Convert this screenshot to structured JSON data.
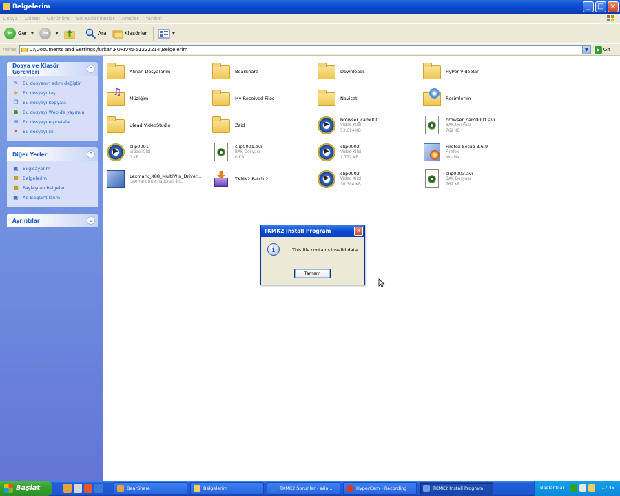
{
  "window": {
    "title": "Belgelerim",
    "controls": [
      "_",
      "□",
      "×"
    ]
  },
  "menu": [
    "Dosya",
    "Düzen",
    "Görünüm",
    "Sık Kullanılanlar",
    "Araçlar",
    "Yardım"
  ],
  "toolbar": {
    "back": "Geri",
    "search": "Ara",
    "folders": "Klasörler"
  },
  "address": {
    "label": "Adres",
    "path": "C:\\Documents and Settings\\furkan.FURKAN-51222214\\Belgelerim",
    "go": "Git"
  },
  "taskpane": {
    "file_tasks": {
      "title": "Dosya ve Klasör Görevleri",
      "items": [
        {
          "label": "Bu dosyanın adını değiştir",
          "icon": "rename-icon"
        },
        {
          "label": "Bu dosyayı taşı",
          "icon": "move-icon"
        },
        {
          "label": "Bu dosyayı kopyala",
          "icon": "copy-icon"
        },
        {
          "label": "Bu dosyayı Web'de yayımla",
          "icon": "web-publish-icon"
        },
        {
          "label": "Bu dosyayı e-postala",
          "icon": "email-icon"
        },
        {
          "label": "Bu dosyayı sil",
          "icon": "delete-icon"
        }
      ]
    },
    "other_places": {
      "title": "Diğer Yerler",
      "items": [
        {
          "label": "Bilgisayarım",
          "icon": "computer-icon"
        },
        {
          "label": "Belgelerim",
          "icon": "documents-icon"
        },
        {
          "label": "Paylaşılan Belgeler",
          "icon": "shared-folder-icon"
        },
        {
          "label": "Ağ Bağlantılarım",
          "icon": "network-icon"
        }
      ]
    },
    "details": {
      "title": "Ayrıntılar"
    }
  },
  "files": [
    {
      "name": "Alınan Dosyalarım",
      "type": "folder",
      "sub1": "",
      "sub2": ""
    },
    {
      "name": "BearShare",
      "type": "folder",
      "sub1": "",
      "sub2": ""
    },
    {
      "name": "Downloads",
      "type": "folder",
      "sub1": "",
      "sub2": ""
    },
    {
      "name": "HyPer Videolar",
      "type": "folder",
      "sub1": "",
      "sub2": ""
    },
    {
      "name": "Müziğim",
      "type": "music",
      "sub1": "",
      "sub2": ""
    },
    {
      "name": "My Received Files",
      "type": "folder",
      "sub1": "",
      "sub2": ""
    },
    {
      "name": "Navicat",
      "type": "folder",
      "sub1": "",
      "sub2": ""
    },
    {
      "name": "Resimlerim",
      "type": "pictures",
      "sub1": "",
      "sub2": ""
    },
    {
      "name": "Ulead VideoStudio",
      "type": "folder",
      "sub1": "",
      "sub2": ""
    },
    {
      "name": "Zaid",
      "type": "folder",
      "sub1": "",
      "sub2": ""
    },
    {
      "name": "browser_cam0001",
      "type": "media",
      "sub1": "Video Klibi",
      "sub2": "53.614 KB"
    },
    {
      "name": "browser_cam0001.avi",
      "type": "doc",
      "sub1": "BAK Dosyası",
      "sub2": "762 KB"
    },
    {
      "name": "clip0001",
      "type": "media",
      "sub1": "Video Klibi",
      "sub2": "0 KB"
    },
    {
      "name": "clip0001.avi",
      "type": "doc",
      "sub1": "BAK Dosyası",
      "sub2": "0 KB"
    },
    {
      "name": "clip0002",
      "type": "media",
      "sub1": "Video Klibi",
      "sub2": "1.737 KB"
    },
    {
      "name": "Firefox Setup 3.6.9",
      "type": "setup",
      "sub1": "Firefox",
      "sub2": "Mozilla"
    },
    {
      "name": "Lexmark_X88_MultiWin_Driver...",
      "type": "lexmark",
      "sub1": "Lexmark International, Inc.",
      "sub2": ""
    },
    {
      "name": "TKMK2 Patch 2",
      "type": "patch",
      "sub1": "",
      "sub2": ""
    },
    {
      "name": "clip0003",
      "type": "media",
      "sub1": "Video Klibi",
      "sub2": "16.384 KB"
    },
    {
      "name": "clip0003.avi",
      "type": "doc",
      "sub1": "BAK Dosyası",
      "sub2": "762 KB"
    }
  ],
  "dialog": {
    "title": "TKMK2 Install Program",
    "message": "This file contains invalid data.",
    "ok": "Tamam",
    "icon": "info-icon"
  },
  "taskbar": {
    "start": "Başlat",
    "tasks": [
      {
        "label": "BearShare",
        "active": false,
        "color": "#e8a23a"
      },
      {
        "label": "Belgelerim",
        "active": false,
        "color": "#f2cd5e"
      },
      {
        "label": "TKMK2 Sorunlar - Win...",
        "active": false,
        "color": "#2e7bd8"
      },
      {
        "label": "HyperCam - Recording",
        "active": false,
        "color": "#d83a2a"
      },
      {
        "label": "TKMK2 Install Program",
        "active": true,
        "color": "#6a9ae8"
      }
    ],
    "tray": {
      "lang": "Bağlantılar",
      "clock": "17:45"
    }
  }
}
